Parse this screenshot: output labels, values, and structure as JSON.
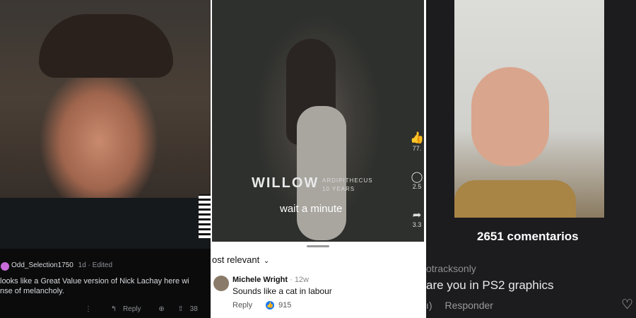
{
  "panel1": {
    "username": "Odd_Selection1750",
    "meta": "1d · Edited",
    "comment_line1": "looks like a Great Value version of Nick Lachay here wi",
    "comment_line2": "nse of melancholy.",
    "more": "⋮",
    "reply_label": "Reply",
    "vote_count": "38"
  },
  "panel2": {
    "overlay_title": "WILLOW",
    "overlay_sub1": "ARDIPITHECUS",
    "overlay_sub2": "10 YEARS",
    "subtitle": "wait a minute",
    "side_count1": "77.",
    "side_count2": "2.5",
    "side_count3": "3.3",
    "sort_label": "ost relevant",
    "commenter": "Michele Wright",
    "time": "· 12w",
    "comment": "Sounds like a cat in labour",
    "reply_label": "Reply",
    "like_count": "915"
  },
  "panel3": {
    "comments_count": "2651 comentarios",
    "username": "otracksonly",
    "comment": "are you in PS2 graphics",
    "reply_label": "Responder",
    "left_fragment": "ı)"
  }
}
